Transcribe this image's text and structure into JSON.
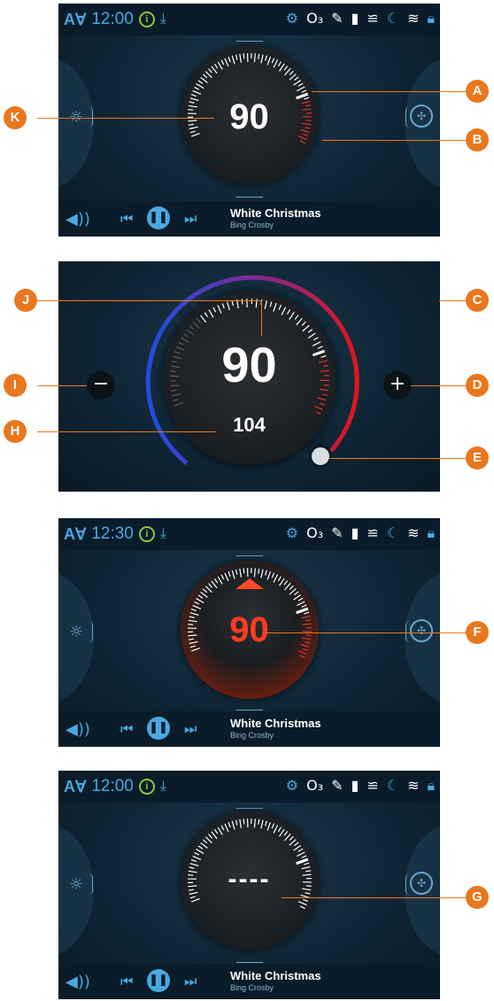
{
  "screen1": {
    "status": {
      "av": "A∀",
      "time": "12:00"
    },
    "dial_value": "90",
    "media": {
      "title": "White Christmas",
      "artist": "Bing Crosby"
    }
  },
  "screen2": {
    "dial_value": "90",
    "secondary_value": "104",
    "minus": "−",
    "plus": "+"
  },
  "screen3": {
    "status": {
      "av": "A∀",
      "time": "12:30"
    },
    "dial_value": "90",
    "media": {
      "title": "White Christmas",
      "artist": "Bing Crosby"
    }
  },
  "screen4": {
    "status": {
      "av": "A∀",
      "time": "12:00"
    },
    "dial_value": "----",
    "media": {
      "title": "White Christmas",
      "artist": "Bing Crosby"
    }
  },
  "callouts": [
    "A",
    "B",
    "C",
    "D",
    "E",
    "F",
    "G",
    "H",
    "I",
    "J",
    "K"
  ],
  "colors": {
    "accent": "#4aa8e0",
    "callout": "#e8771e",
    "alert": "#ff3b1f",
    "info": "#8dc63f"
  },
  "icons": [
    "download-icon",
    "gear-icon",
    "ozone-icon",
    "clean-icon",
    "filter-icon",
    "heat-icon",
    "moon-icon",
    "wifi-icon",
    "lock-icon",
    "sun-icon",
    "fan-icon",
    "volume-icon",
    "prev-icon",
    "pause-icon",
    "next-icon"
  ]
}
